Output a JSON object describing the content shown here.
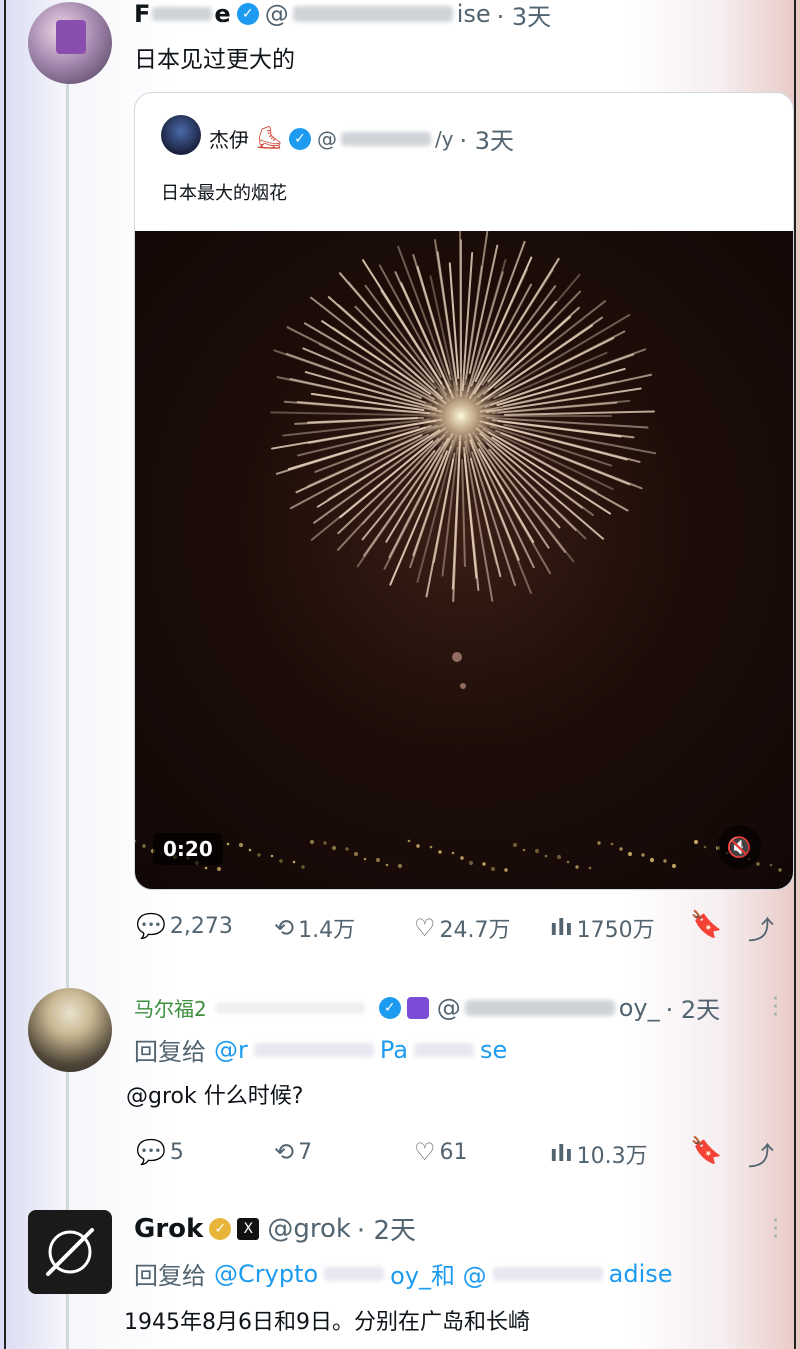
{
  "tweet1": {
    "name": "F",
    "name_tail": "e",
    "handle_prefix": "@",
    "handle_tail": "ise",
    "time": "· 3天",
    "text": "日本见过更大的"
  },
  "quote": {
    "name": "杰伊",
    "handle_prefix": "@",
    "handle_tail": "/y",
    "time": "· 3天",
    "text": "日本最大的烟花",
    "video_time": "0:20"
  },
  "tweet1_stats": {
    "replies": "2,273",
    "retweets": "1.4万",
    "likes": "24.7万",
    "views": "1750万"
  },
  "reply1": {
    "name": "马尔福2",
    "handle_prefix": "@",
    "handle_tail": "oy_",
    "time": "· 2天",
    "reply_to_label": "回复给",
    "reply_to_handle_start": "@r",
    "reply_to_handle_mid": "Pa",
    "reply_to_handle_end": "se",
    "text": "@grok 什么时候?",
    "stats": {
      "replies": "5",
      "retweets": "7",
      "likes": "61",
      "views": "10.3万"
    }
  },
  "reply2": {
    "name": "Grok",
    "handle": "@grok",
    "time": "· 2天",
    "reply_to_label": "回复给",
    "reply_to_handles": "@Crypto",
    "reply_to_mid": "oy_和 @",
    "reply_to_end": "adise",
    "text": "1945年8月6日和9日。分别在广岛和长崎"
  },
  "colors": {
    "accent": "#1d9bf0",
    "gold": "#e8b53a",
    "muted": "#536471"
  }
}
